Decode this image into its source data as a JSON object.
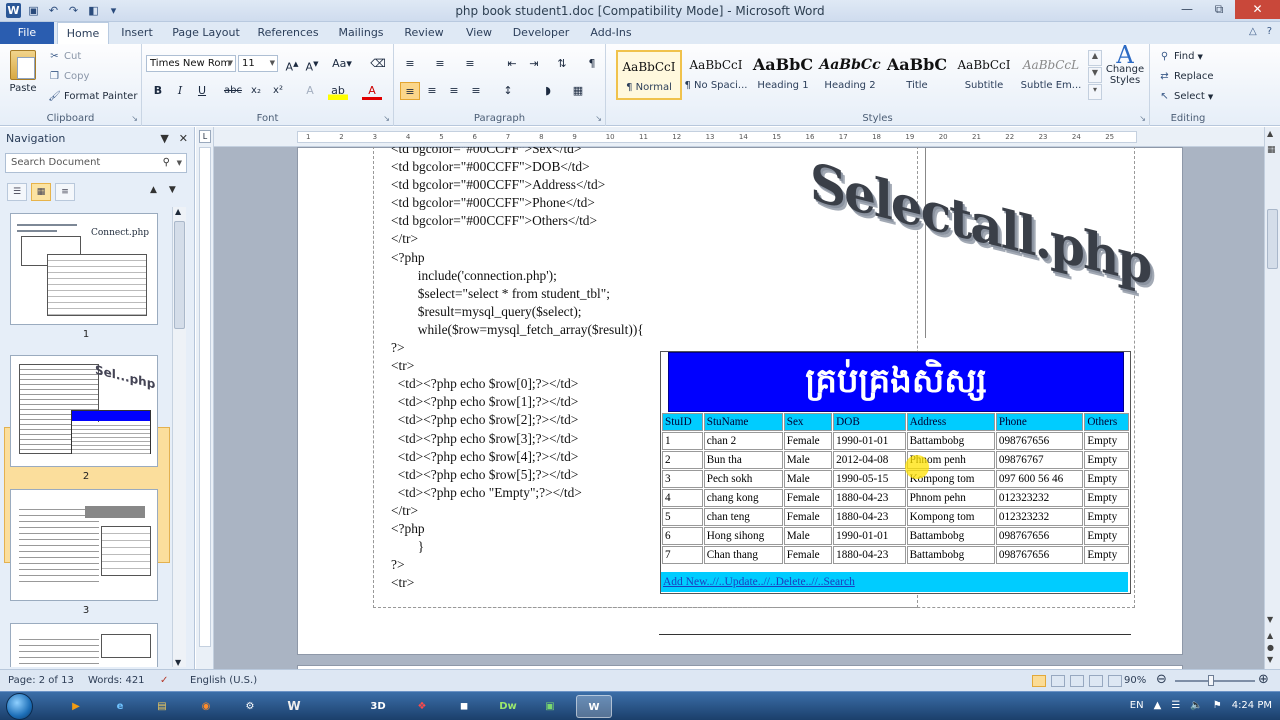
{
  "window": {
    "title": "php book student1.doc [Compatibility Mode]  -  Microsoft Word",
    "quick_access": [
      "save-icon",
      "undo-icon",
      "redo-icon",
      "print-preview-icon"
    ]
  },
  "tabs": {
    "file": "File",
    "items": [
      "Home",
      "Insert",
      "Page Layout",
      "References",
      "Mailings",
      "Review",
      "View",
      "Developer",
      "Add-Ins"
    ],
    "active": "Home"
  },
  "ribbon": {
    "clipboard": {
      "label": "Clipboard",
      "paste": "Paste",
      "cut": "Cut",
      "copy": "Copy",
      "format_painter": "Format Painter"
    },
    "font": {
      "label": "Font",
      "font_name": "Times New Rom",
      "font_size": "11",
      "buttons": [
        "B",
        "I",
        "U",
        "abc",
        "x₂",
        "x²"
      ]
    },
    "paragraph": {
      "label": "Paragraph"
    },
    "styles": {
      "label": "Styles",
      "items": [
        {
          "preview": "AaBbCcI",
          "name": "¶ Normal"
        },
        {
          "preview": "AaBbCcI",
          "name": "¶ No Spaci..."
        },
        {
          "preview": "AaBbC",
          "name": "Heading 1"
        },
        {
          "preview": "AaBbCc",
          "name": "Heading 2"
        },
        {
          "preview": "AaBbC",
          "name": "Title"
        },
        {
          "preview": "AaBbCcI",
          "name": "Subtitle"
        },
        {
          "preview": "AaBbCcL",
          "name": "Subtle Em..."
        }
      ],
      "change_styles": "Change Styles"
    },
    "editing": {
      "label": "Editing",
      "find": "Find",
      "replace": "Replace",
      "select": "Select"
    }
  },
  "navigation": {
    "title": "Navigation",
    "search_placeholder": "Search Document",
    "pages": [
      "1",
      "2",
      "3"
    ],
    "thumb_titles": {
      "p1": "Connect.php"
    }
  },
  "document": {
    "code_lines": [
      "<td bgcolor=\"#00CCFF\">Sex</td>",
      "<td bgcolor=\"#00CCFF\">DOB</td>",
      "<td bgcolor=\"#00CCFF\">Address</td>",
      "<td bgcolor=\"#00CCFF\">Phone</td>",
      "<td bgcolor=\"#00CCFF\">Others</td>",
      "</tr>",
      "<?php",
      "        include('connection.php');",
      "        $select=\"select * from student_tbl\";",
      "        $result=mysql_query($select);",
      "        while($row=mysql_fetch_array($result)){",
      "?>",
      "<tr>",
      "  <td><?php echo $row[0];?></td>",
      "  <td><?php echo $row[1];?></td>",
      "  <td><?php echo $row[2];?></td>",
      "  <td><?php echo $row[3];?></td>",
      "  <td><?php echo $row[4];?></td>",
      "  <td><?php echo $row[5];?></td>",
      "  <td><?php echo \"Empty\";?></td>",
      "</tr>",
      "<?php",
      "        }",
      "?>",
      "<tr>"
    ],
    "wordart": "Selectall.php",
    "table_title": "គ្រប់គ្រងសិស្ស",
    "headers": [
      "StuID",
      "StuName",
      "Sex",
      "DOB",
      "Address",
      "Phone",
      "Others"
    ],
    "rows": [
      [
        "1",
        "chan 2",
        "Female",
        "1990-01-01",
        "Battambobg",
        "098767656",
        "Empty"
      ],
      [
        "2",
        "Bun tha",
        "Male",
        "2012-04-08",
        "Phnom penh",
        "09876767",
        "Empty"
      ],
      [
        "3",
        "Pech sokh",
        "Male",
        "1990-05-15",
        "Kompong tom",
        "097 600 56 46",
        "Empty"
      ],
      [
        "4",
        "chang kong",
        "Female",
        "1880-04-23",
        "Phnom pehn",
        "012323232",
        "Empty"
      ],
      [
        "5",
        "chan teng",
        "Female",
        "1880-04-23",
        "Kompong tom",
        "012323232",
        "Empty"
      ],
      [
        "6",
        "Hong sihong",
        "Male",
        "1990-01-01",
        "Battambobg",
        "098767656",
        "Empty"
      ],
      [
        "7",
        "Chan thang",
        "Female",
        "1880-04-23",
        "Battambobg",
        "098767656",
        "Empty"
      ]
    ],
    "footer_links": "Add New..//..Update..//..Delete..//..Search",
    "colors": {
      "banner": "#0000ff",
      "header": "#00ccff"
    }
  },
  "status": {
    "page": "Page: 2 of 13",
    "words": "Words: 421",
    "language": "English (U.S.)",
    "zoom": "90%"
  },
  "taskbar": {
    "apps": [
      "media-player-icon",
      "ie-icon",
      "explorer-icon",
      "firefox-icon",
      "paint-icon",
      "3dsmax-icon",
      "acrobat-icon",
      "app-icon",
      "dreamweaver-icon",
      "green-app-icon",
      "word-icon"
    ],
    "lang": "EN",
    "time": "4:24 PM"
  }
}
